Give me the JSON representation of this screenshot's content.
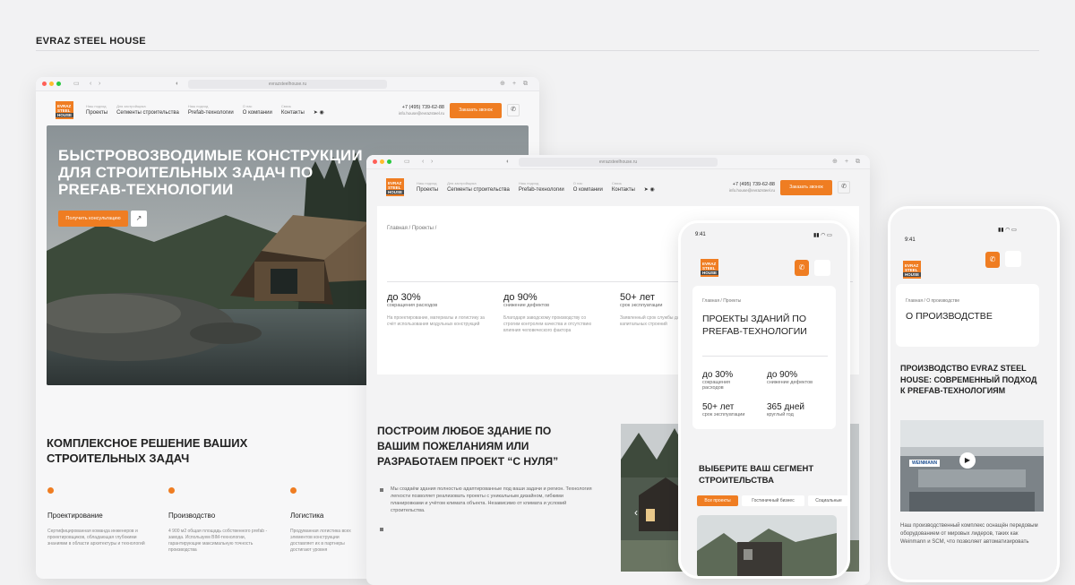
{
  "brand": "EVRAZ STEEL HOUSE",
  "colors": {
    "accent": "#ef7d22",
    "dark": "#222222",
    "background": "#f2f2f3"
  },
  "logo": {
    "line1": "EVRAZ",
    "line2": "STEEL",
    "line3": "HOUSE"
  },
  "nav": [
    {
      "sub": "Наш подход",
      "label": "Проекты"
    },
    {
      "sub": "Для застройщика",
      "label": "Сегменты строительства"
    },
    {
      "sub": "Наш подход",
      "label": "Prefab-технологии"
    },
    {
      "sub": "О нас",
      "label": "О компании"
    },
    {
      "sub": "Связь",
      "label": "Контакты"
    }
  ],
  "header": {
    "phone": "+7 (495) 739-62-88",
    "email": "info.house@evrazsteel.ru",
    "cta": "Заказать звонок",
    "phone_icon": "phone-icon",
    "url1": "evrazsteelhouse.ru",
    "url2": "evrazsteelhouse.ru"
  },
  "hero": {
    "title": "Быстровозводимые конструкции для строительных задач по prefab-технологии",
    "button": "Получить консультацию",
    "arrow": "↗"
  },
  "complex": {
    "title": "Комплексное решение ваших строительных задач",
    "items": [
      {
        "title": "Проектирование",
        "text": "Сертифицированная команда инженеров и проектировщиков, обладающая глубокими знаниями в области архитектуры и технологий"
      },
      {
        "title": "Производство",
        "text": "4 900 м2 общая площадь собственного prefab - завода. Используем BIM-технологии, гарантирующие максимальную точность производства"
      },
      {
        "title": "Логистика",
        "text": "Продуманная логистика всех элементов конструкции доставляет их в партнеры достигают уровня"
      }
    ]
  },
  "projects_page": {
    "breadcrumb": "Главная / Проекты /",
    "stats": [
      {
        "value": "до 30%",
        "label": "сокращения расходов",
        "text": "На проектирование, материалы и логистику за счёт использования модульных конструкций"
      },
      {
        "value": "до 90%",
        "label": "снижение дефектов",
        "text": "Благодаря заводскому производству со строгим контролем качества и отсутствию влияния человеческого фактора"
      },
      {
        "value": "50+ лет",
        "label": "срок эксплуатации",
        "text": "Заявленный срок службы для капитальных строений"
      }
    ],
    "build_title": "Построим любое здание по вашим пожеланиям или разработаем проект “с нуля”",
    "build_text": "Мы создаём здания полностью адаптированные под ваши задачи и регион. Технология легкости позволяет реализовать проекты с уникальным дизайном, гибкими планировками и учётом климата объекта. Независимо от климата и условий строительства.",
    "prev_arrow": "‹"
  },
  "phone1": {
    "time": "9:41",
    "breadcrumb": "Главная / Проекты",
    "title": "Проекты зданий по prefab-технологии",
    "stats": [
      {
        "value": "до 30%",
        "label": "сокращения расходов"
      },
      {
        "value": "до 90%",
        "label": "снижение дефектов"
      },
      {
        "value": "50+ лет",
        "label": "срок эксплуатации"
      },
      {
        "value": "365 дней",
        "label": "круглый год"
      }
    ],
    "segment_title": "Выберите ваш сегмент строительства",
    "pills": [
      "Все проекты",
      "Гостиничный бизнес",
      "Социальные"
    ]
  },
  "phone2": {
    "time": "9:41",
    "breadcrumb": "Главная / О производстве",
    "title": "О производстве",
    "section_title": "Производство EVRAZ Steel House: современный подход к prefab-технологиям",
    "video_label": "WEINMANN",
    "text": "Наш производственный комплекс оснащён передовым оборудованием от мировых лидеров, таких как Weinmann и SCM, что позволяет автоматизировать"
  }
}
